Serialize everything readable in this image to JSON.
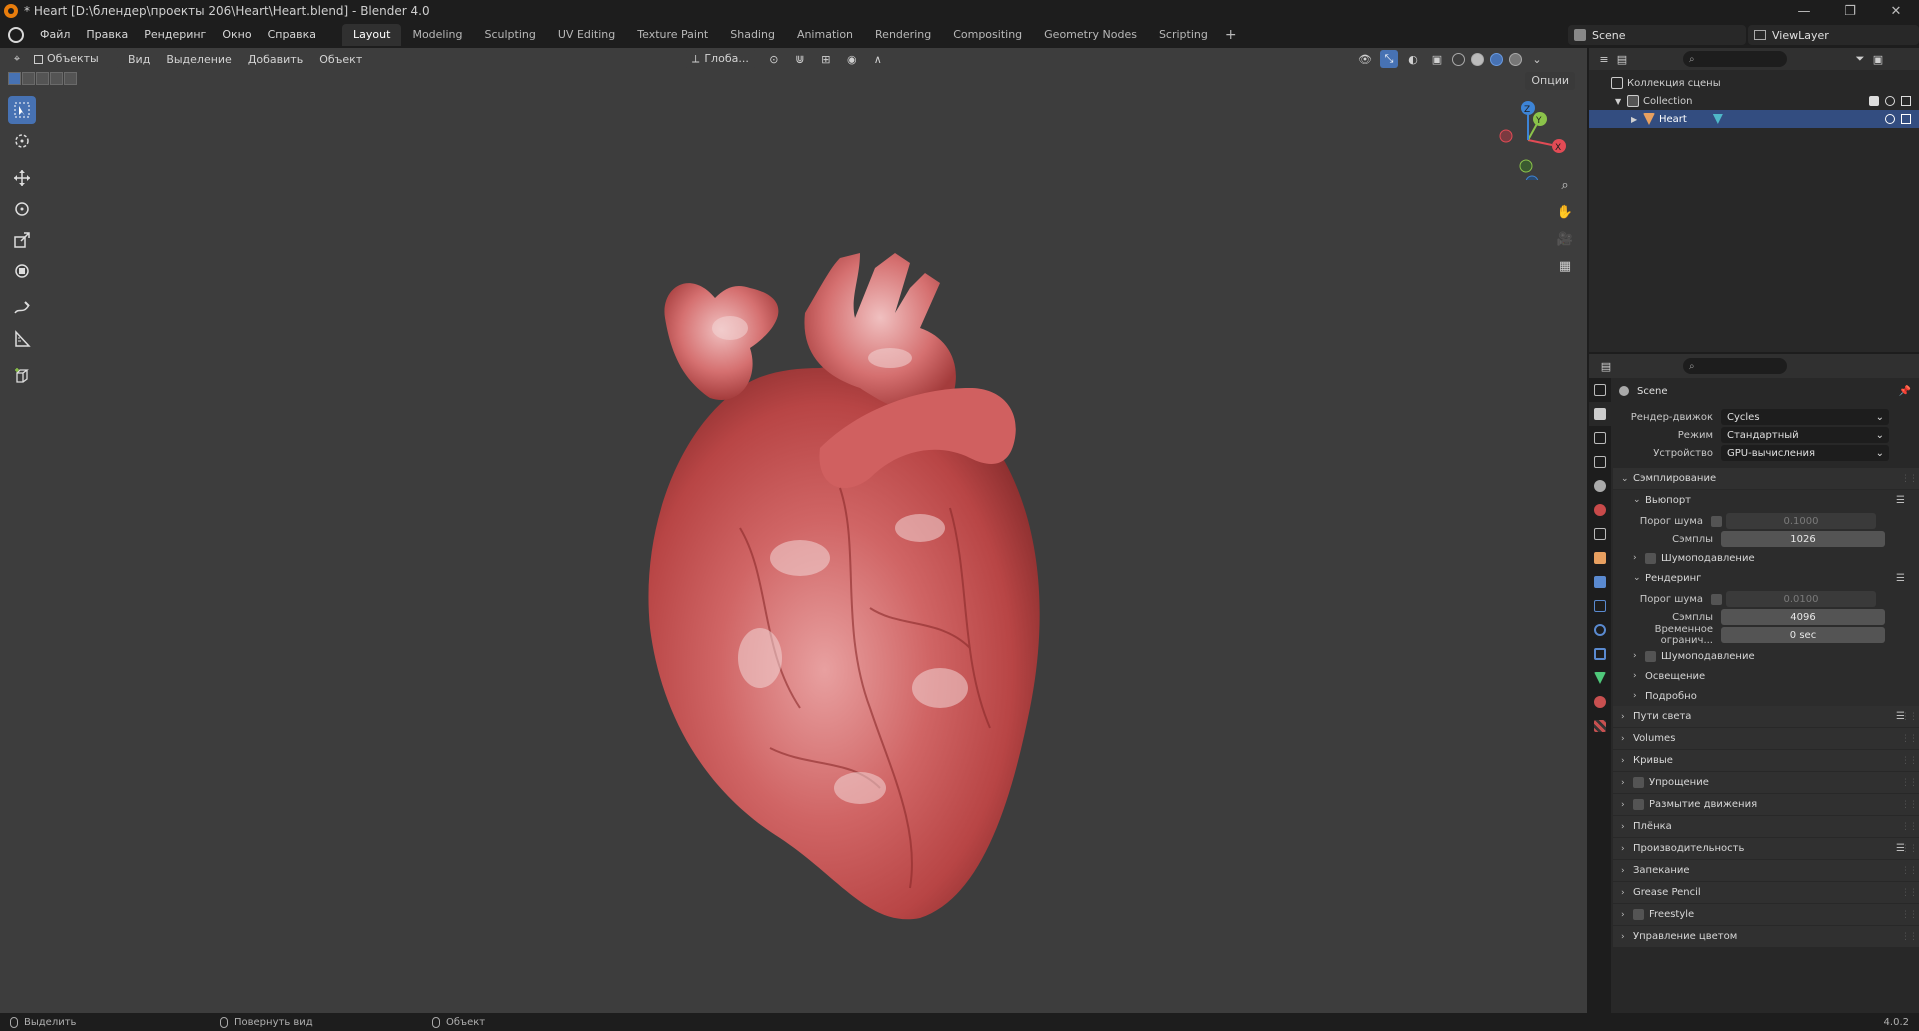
{
  "window": {
    "title": "* Heart [D:\\блендер\\проекты 206\\Heart\\Heart.blend] - Blender 4.0",
    "minimize": "—",
    "maximize": "❐",
    "close": "✕"
  },
  "menubar": {
    "menus": [
      "Файл",
      "Правка",
      "Рендеринг",
      "Окно",
      "Справка"
    ],
    "workspaces": [
      "Layout",
      "Modeling",
      "Sculpting",
      "UV Editing",
      "Texture Paint",
      "Shading",
      "Animation",
      "Rendering",
      "Compositing",
      "Geometry Nodes",
      "Scripting"
    ],
    "active_workspace": "Layout",
    "add_workspace": "+",
    "scene_name": "Scene",
    "view_layer": "ViewLayer"
  },
  "viewport": {
    "mode": "Объекты",
    "menus": [
      "Вид",
      "Выделение",
      "Добавить",
      "Объект"
    ],
    "transform_orientation": "Глоба...",
    "options": "Опции",
    "object_name": "Heart"
  },
  "outliner": {
    "scene_collection": "Коллекция сцены",
    "collection": "Collection",
    "object": "Heart"
  },
  "properties": {
    "context": "Scene",
    "render_engine_label": "Рендер-движок",
    "render_engine": "Cycles",
    "mode_label": "Режим",
    "mode": "Стандартный",
    "device_label": "Устройство",
    "device": "GPU-вычисления",
    "sampling": "Сэмплирование",
    "viewport_panel": "Вьюпорт",
    "noise_threshold_label": "Порог шума",
    "viewport_noise_threshold": "0.1000",
    "samples_label": "Сэмплы",
    "viewport_samples": "1026",
    "denoise": "Шумоподавление",
    "render_panel": "Рендеринг",
    "render_noise_threshold": "0.0100",
    "render_samples": "4096",
    "time_limit_label": "Временное огранич...",
    "time_limit": "0 sec",
    "lights": "Освещение",
    "advanced": "Подробно",
    "panels": [
      {
        "label": "Пути света",
        "has_checkbox": false,
        "has_list": true
      },
      {
        "label": "Volumes",
        "has_checkbox": false,
        "has_list": false
      },
      {
        "label": "Кривые",
        "has_checkbox": false,
        "has_list": false
      },
      {
        "label": "Упрощение",
        "has_checkbox": true,
        "has_list": false
      },
      {
        "label": "Размытие движения",
        "has_checkbox": true,
        "has_list": false
      },
      {
        "label": "Плёнка",
        "has_checkbox": false,
        "has_list": false
      },
      {
        "label": "Производительность",
        "has_checkbox": false,
        "has_list": true
      },
      {
        "label": "Запекание",
        "has_checkbox": false,
        "has_list": false
      },
      {
        "label": "Grease Pencil",
        "has_checkbox": false,
        "has_list": false
      },
      {
        "label": "Freestyle",
        "has_checkbox": true,
        "has_list": false
      },
      {
        "label": "Управление цветом",
        "has_checkbox": false,
        "has_list": false
      }
    ]
  },
  "statusbar": {
    "select": "Выделить",
    "rotate_view": "Повернуть вид",
    "object": "Объект",
    "version": "4.0.2"
  },
  "gizmo": {
    "x": "X",
    "y": "Y",
    "z": "Z"
  },
  "colors": {
    "accent": "#4772b3",
    "selection": "#334d80",
    "axis_x": "#e24b55",
    "axis_y": "#8bc34a",
    "axis_z": "#3d84d6",
    "heart": "#c94848"
  }
}
